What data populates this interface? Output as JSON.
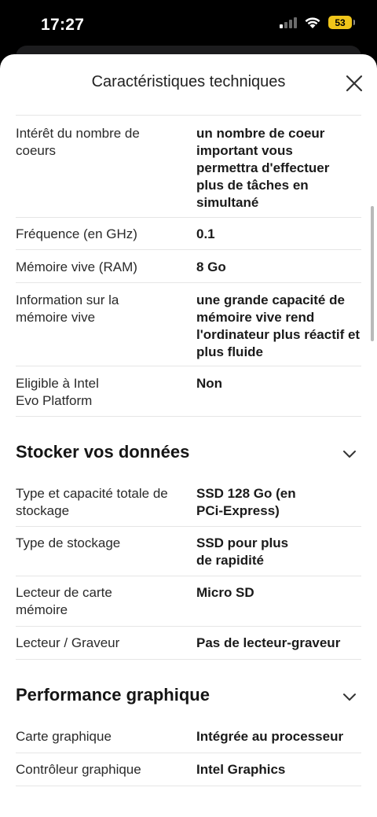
{
  "status_bar": {
    "time": "17:27",
    "battery": "53"
  },
  "sheet": {
    "title": "Caractéristiques techniques",
    "close_icon": "close-icon"
  },
  "processor_rows": [
    {
      "label": "Intérêt du nombre de coeurs",
      "value": "un nombre de coeur important vous permettra d'effectuer plus de tâches en simultané"
    },
    {
      "label": "Fréquence (en GHz)",
      "value": "0.1"
    },
    {
      "label": "Mémoire vive (RAM)",
      "value": "8 Go"
    },
    {
      "label": "Information sur la mémoire vive",
      "value": "une grande capacité de mémoire vive rend l'ordinateur plus réactif et plus fluide"
    },
    {
      "label": "Eligible à Intel Evo Platform",
      "value": "Non"
    }
  ],
  "storage_section": {
    "title": "Stocker vos données",
    "rows": [
      {
        "label": "Type et capacité totale de stockage",
        "value": "SSD 128 Go (en PCi-Express)"
      },
      {
        "label": "Type de stockage",
        "value": "SSD pour plus de rapidité"
      },
      {
        "label": "Lecteur de carte mémoire",
        "value": "Micro SD"
      },
      {
        "label": "Lecteur / Graveur",
        "value": "Pas de lecteur-graveur"
      }
    ]
  },
  "graphics_section": {
    "title": "Performance graphique",
    "rows": [
      {
        "label": "Carte graphique",
        "value": "Intégrée au processeur"
      },
      {
        "label": "Contrôleur graphique",
        "value": "Intel Graphics"
      }
    ]
  }
}
